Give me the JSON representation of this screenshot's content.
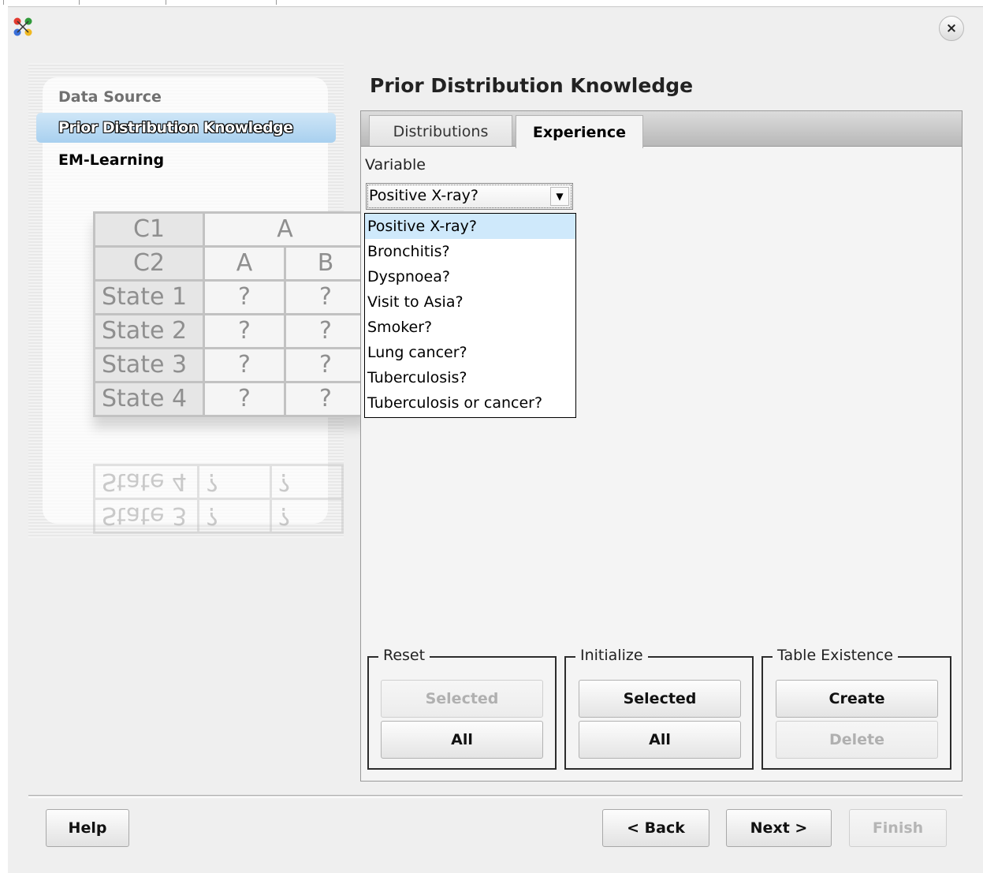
{
  "window": {
    "icon": "network-app-icon",
    "close_label": "×"
  },
  "wizard_steps": [
    {
      "label": "Data Source",
      "state": "done"
    },
    {
      "label": "Prior Distribution Knowledge",
      "state": "active"
    },
    {
      "label": "EM-Learning",
      "state": "pending"
    }
  ],
  "decoration_table": {
    "header1": [
      "C1",
      "A"
    ],
    "header2": [
      "C2",
      "A",
      "B"
    ],
    "rows": [
      [
        "State 1",
        "?",
        "?"
      ],
      [
        "State 2",
        "?",
        "?"
      ],
      [
        "State 3",
        "?",
        "?"
      ],
      [
        "State 4",
        "?",
        "?"
      ]
    ],
    "reflection_rows": [
      [
        "State 4",
        "?",
        "?"
      ],
      [
        "State 3",
        "?",
        "?"
      ]
    ]
  },
  "page_title": "Prior Distribution Knowledge",
  "tabs": [
    {
      "label": "Distributions",
      "selected": false
    },
    {
      "label": "Experience",
      "selected": true
    }
  ],
  "variable": {
    "label": "Variable",
    "selected": "Positive X-ray?",
    "options": [
      "Positive X-ray?",
      "Bronchitis?",
      "Dyspnoea?",
      "Visit to Asia?",
      "Smoker?",
      "Lung cancer?",
      "Tuberculosis?",
      "Tuberculosis or cancer?"
    ]
  },
  "groups": {
    "reset": {
      "title": "Reset",
      "selected_label": "Selected",
      "all_label": "All"
    },
    "initialize": {
      "title": "Initialize",
      "selected_label": "Selected",
      "all_label": "All"
    },
    "table_existence": {
      "title": "Table Existence",
      "create_label": "Create",
      "delete_label": "Delete"
    }
  },
  "footer": {
    "help_label": "Help",
    "back_label": "< Back",
    "next_label": "Next >",
    "finish_label": "Finish"
  },
  "colors": {
    "dialog_bg": "#efefef",
    "active_step_bg": "#a8d0ef",
    "dropdown_highlight": "#cfe9fb"
  }
}
